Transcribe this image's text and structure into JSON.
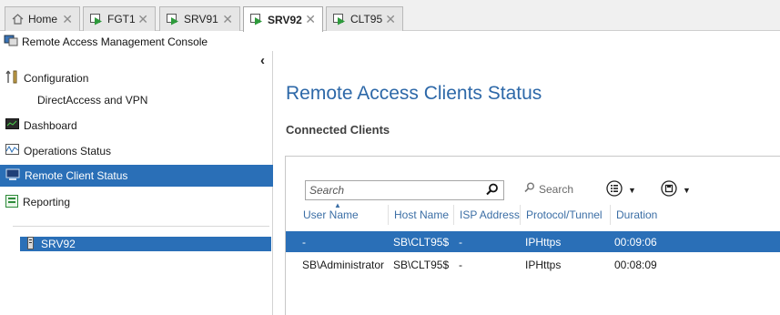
{
  "tabs": [
    {
      "label": "Home",
      "icon": "home-icon",
      "active": false
    },
    {
      "label": "FGT1",
      "icon": "vm-icon",
      "active": false
    },
    {
      "label": "SRV91",
      "icon": "vm-icon",
      "active": false
    },
    {
      "label": "SRV92",
      "icon": "vm-icon",
      "active": true
    },
    {
      "label": "CLT95",
      "icon": "vm-icon",
      "active": false
    }
  ],
  "app": {
    "title": "Remote Access Management Console",
    "icon": "console-icon"
  },
  "nav": {
    "configuration": "Configuration",
    "config_sub": "DirectAccess and VPN",
    "dashboard": "Dashboard",
    "operations_status": "Operations Status",
    "remote_client_status": "Remote Client Status",
    "reporting": "Reporting",
    "server": "SRV92",
    "selected": "Remote Client Status"
  },
  "main": {
    "title": "Remote Access Clients Status",
    "section": "Connected Clients",
    "search_placeholder": "Search",
    "search_button": "Search"
  },
  "grid": {
    "columns": [
      "User Name",
      "Host Name",
      "ISP Address",
      "Protocol/Tunnel",
      "Duration"
    ],
    "rows": [
      {
        "user": "-",
        "host": "SB\\CLT95$",
        "isp": "-",
        "protocol": "IPHttps",
        "duration": "00:09:06",
        "selected": true
      },
      {
        "user": "SB\\Administrator",
        "host": "SB\\CLT95$",
        "isp": "-",
        "protocol": "IPHttps",
        "duration": "00:08:09",
        "selected": false
      }
    ]
  },
  "colors": {
    "accent": "#2a6fb7",
    "title_blue": "#2d68a8",
    "header_blue": "#3b6ea5"
  }
}
